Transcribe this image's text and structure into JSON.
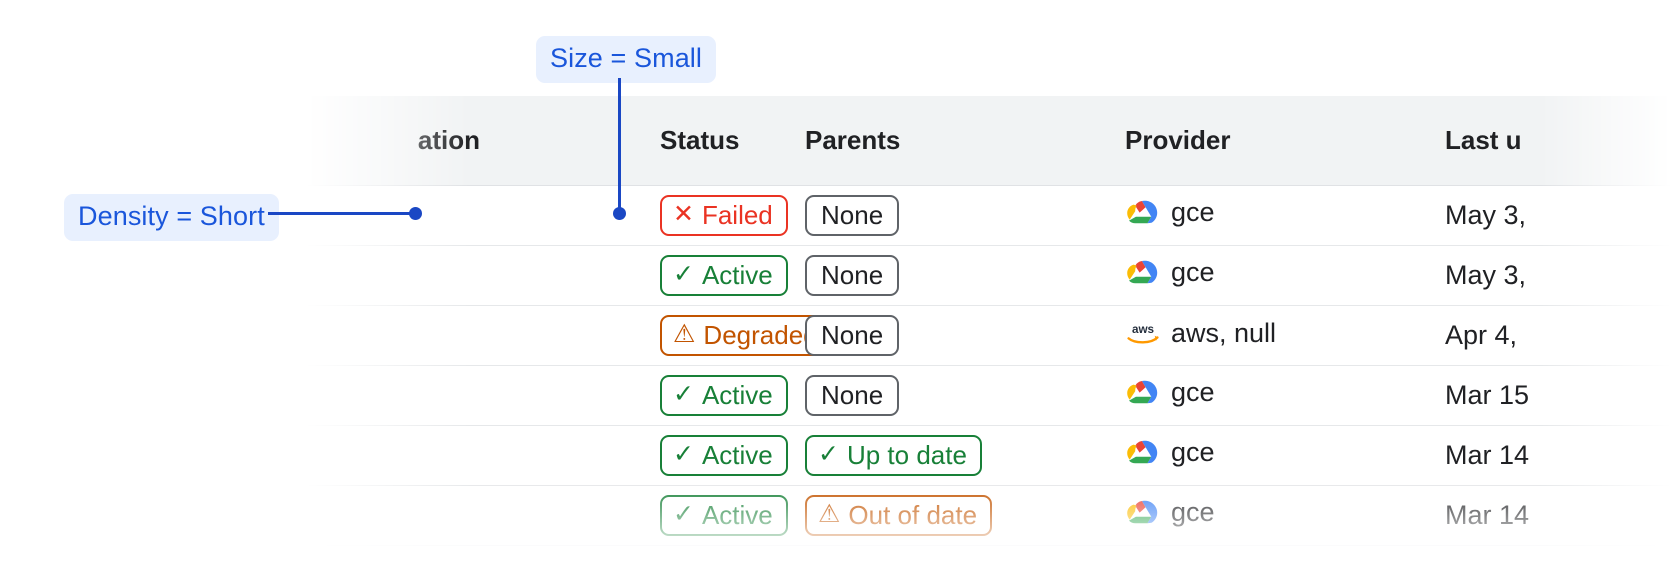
{
  "table": {
    "columns": [
      {
        "key": "name",
        "label": "ation",
        "truncated_left": true
      },
      {
        "key": "status",
        "label": "Status",
        "truncated_left": false
      },
      {
        "key": "parents",
        "label": "Parents",
        "truncated_left": false
      },
      {
        "key": "provider",
        "label": "Provider",
        "truncated_left": false
      },
      {
        "key": "last",
        "label": "Last u",
        "truncated_right": true
      }
    ],
    "rows": [
      {
        "status": {
          "label": "Failed",
          "icon": "close-icon",
          "glyph": "✕",
          "tone": "red"
        },
        "parents": {
          "label": "None",
          "icon": null,
          "glyph": "",
          "tone": "gray"
        },
        "provider": {
          "label": "gce",
          "icon": "google-cloud-icon"
        },
        "last_updated": "May 3,"
      },
      {
        "status": {
          "label": "Active",
          "icon": "check-icon",
          "glyph": "✓",
          "tone": "green"
        },
        "parents": {
          "label": "None",
          "icon": null,
          "glyph": "",
          "tone": "gray"
        },
        "provider": {
          "label": "gce",
          "icon": "google-cloud-icon"
        },
        "last_updated": "May 3,"
      },
      {
        "status": {
          "label": "Degraded",
          "icon": "warning-icon",
          "glyph": "⚠",
          "tone": "orange"
        },
        "parents": {
          "label": "None",
          "icon": null,
          "glyph": "",
          "tone": "gray"
        },
        "provider": {
          "label": "aws, null",
          "icon": "aws-icon"
        },
        "last_updated": "Apr 4,"
      },
      {
        "status": {
          "label": "Active",
          "icon": "check-icon",
          "glyph": "✓",
          "tone": "green"
        },
        "parents": {
          "label": "None",
          "icon": null,
          "glyph": "",
          "tone": "gray"
        },
        "provider": {
          "label": "gce",
          "icon": "google-cloud-icon"
        },
        "last_updated": "Mar 15"
      },
      {
        "status": {
          "label": "Active",
          "icon": "check-icon",
          "glyph": "✓",
          "tone": "green"
        },
        "parents": {
          "label": "Up to date",
          "icon": "check-icon",
          "glyph": "✓",
          "tone": "green"
        },
        "provider": {
          "label": "gce",
          "icon": "google-cloud-icon"
        },
        "last_updated": "Mar 14"
      },
      {
        "status": {
          "label": "Active",
          "icon": "check-icon",
          "glyph": "✓",
          "tone": "green"
        },
        "parents": {
          "label": "Out of date",
          "icon": "warning-icon",
          "glyph": "⚠",
          "tone": "orange"
        },
        "provider": {
          "label": "gce",
          "icon": "google-cloud-icon"
        },
        "last_updated": "Mar 14"
      }
    ]
  },
  "annotations": [
    {
      "id": "size",
      "label": "Size = Small"
    },
    {
      "id": "density",
      "label": "Density = Short"
    }
  ],
  "colors": {
    "annotation_text": "#1a56db",
    "annotation_bg": "#e8f0fe",
    "annotation_line": "#1a47c4",
    "status_failed": "#ea3323",
    "status_active": "#188038",
    "status_degraded": "#c25400",
    "chip_neutral_border": "#5f6368",
    "header_bg": "#f1f3f4",
    "row_divider": "#e6e8ea"
  }
}
